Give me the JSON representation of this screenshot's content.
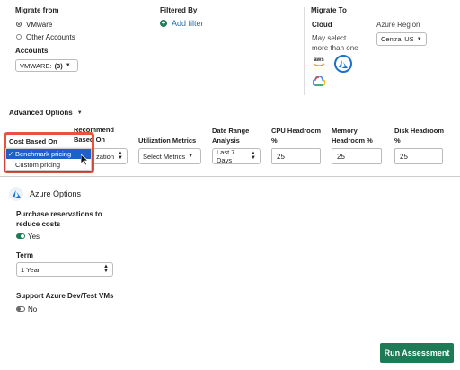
{
  "migrate_from": {
    "title": "Migrate from",
    "options": [
      {
        "label": "VMware",
        "selected": true
      },
      {
        "label": "Other Accounts",
        "selected": false
      }
    ],
    "accounts_label": "Accounts",
    "accounts_value": "VMWARE:",
    "accounts_count": "(3)"
  },
  "filtered_by": {
    "title": "Filtered By",
    "add_filter": "Add filter"
  },
  "migrate_to": {
    "title": "Migrate To",
    "cloud_label": "Cloud",
    "cloud_hint_1": "May select",
    "cloud_hint_2": "more than one",
    "aws_text": "aws",
    "region_label": "Azure Region",
    "region_value": "Central US"
  },
  "advanced_options": {
    "label": "Advanced Options"
  },
  "headers": {
    "cost_based_on": "Cost Based On",
    "recommend_1": "Recommend",
    "recommend_2": "Based On",
    "utilization": "Utilization Metrics",
    "date_range_1": "Date Range",
    "date_range_2": "Analysis",
    "cpu_1": "CPU Headroom",
    "cpu_2": "%",
    "memory_1": "Memory",
    "memory_2": "Headroom %",
    "disk_1": "Disk Headroom",
    "disk_2": "%"
  },
  "cost_dropdown": {
    "options": [
      {
        "label": "Benchmark pricing",
        "selected": true
      },
      {
        "label": "Custom pricing",
        "selected": false
      }
    ],
    "check": "✓"
  },
  "fields": {
    "recommend_value": "zation",
    "utilization_value": "Select Metrics",
    "date_range_value": "Last 7 Days",
    "cpu_value": "25",
    "memory_value": "25",
    "disk_value": "25"
  },
  "azure": {
    "title": "Azure Options",
    "reservations_label_1": "Purchase reservations to",
    "reservations_label_2": "reduce costs",
    "reservations_value": "Yes",
    "term_label": "Term",
    "term_value": "1 Year",
    "devtest_label": "Support Azure Dev/Test VMs",
    "devtest_value": "No"
  },
  "run_button": "Run Assessment",
  "colors": {
    "accent": "#1e7a57",
    "highlight_border": "#e8533f",
    "selection": "#1e5fcc",
    "azure_blue": "#1a73c8"
  }
}
